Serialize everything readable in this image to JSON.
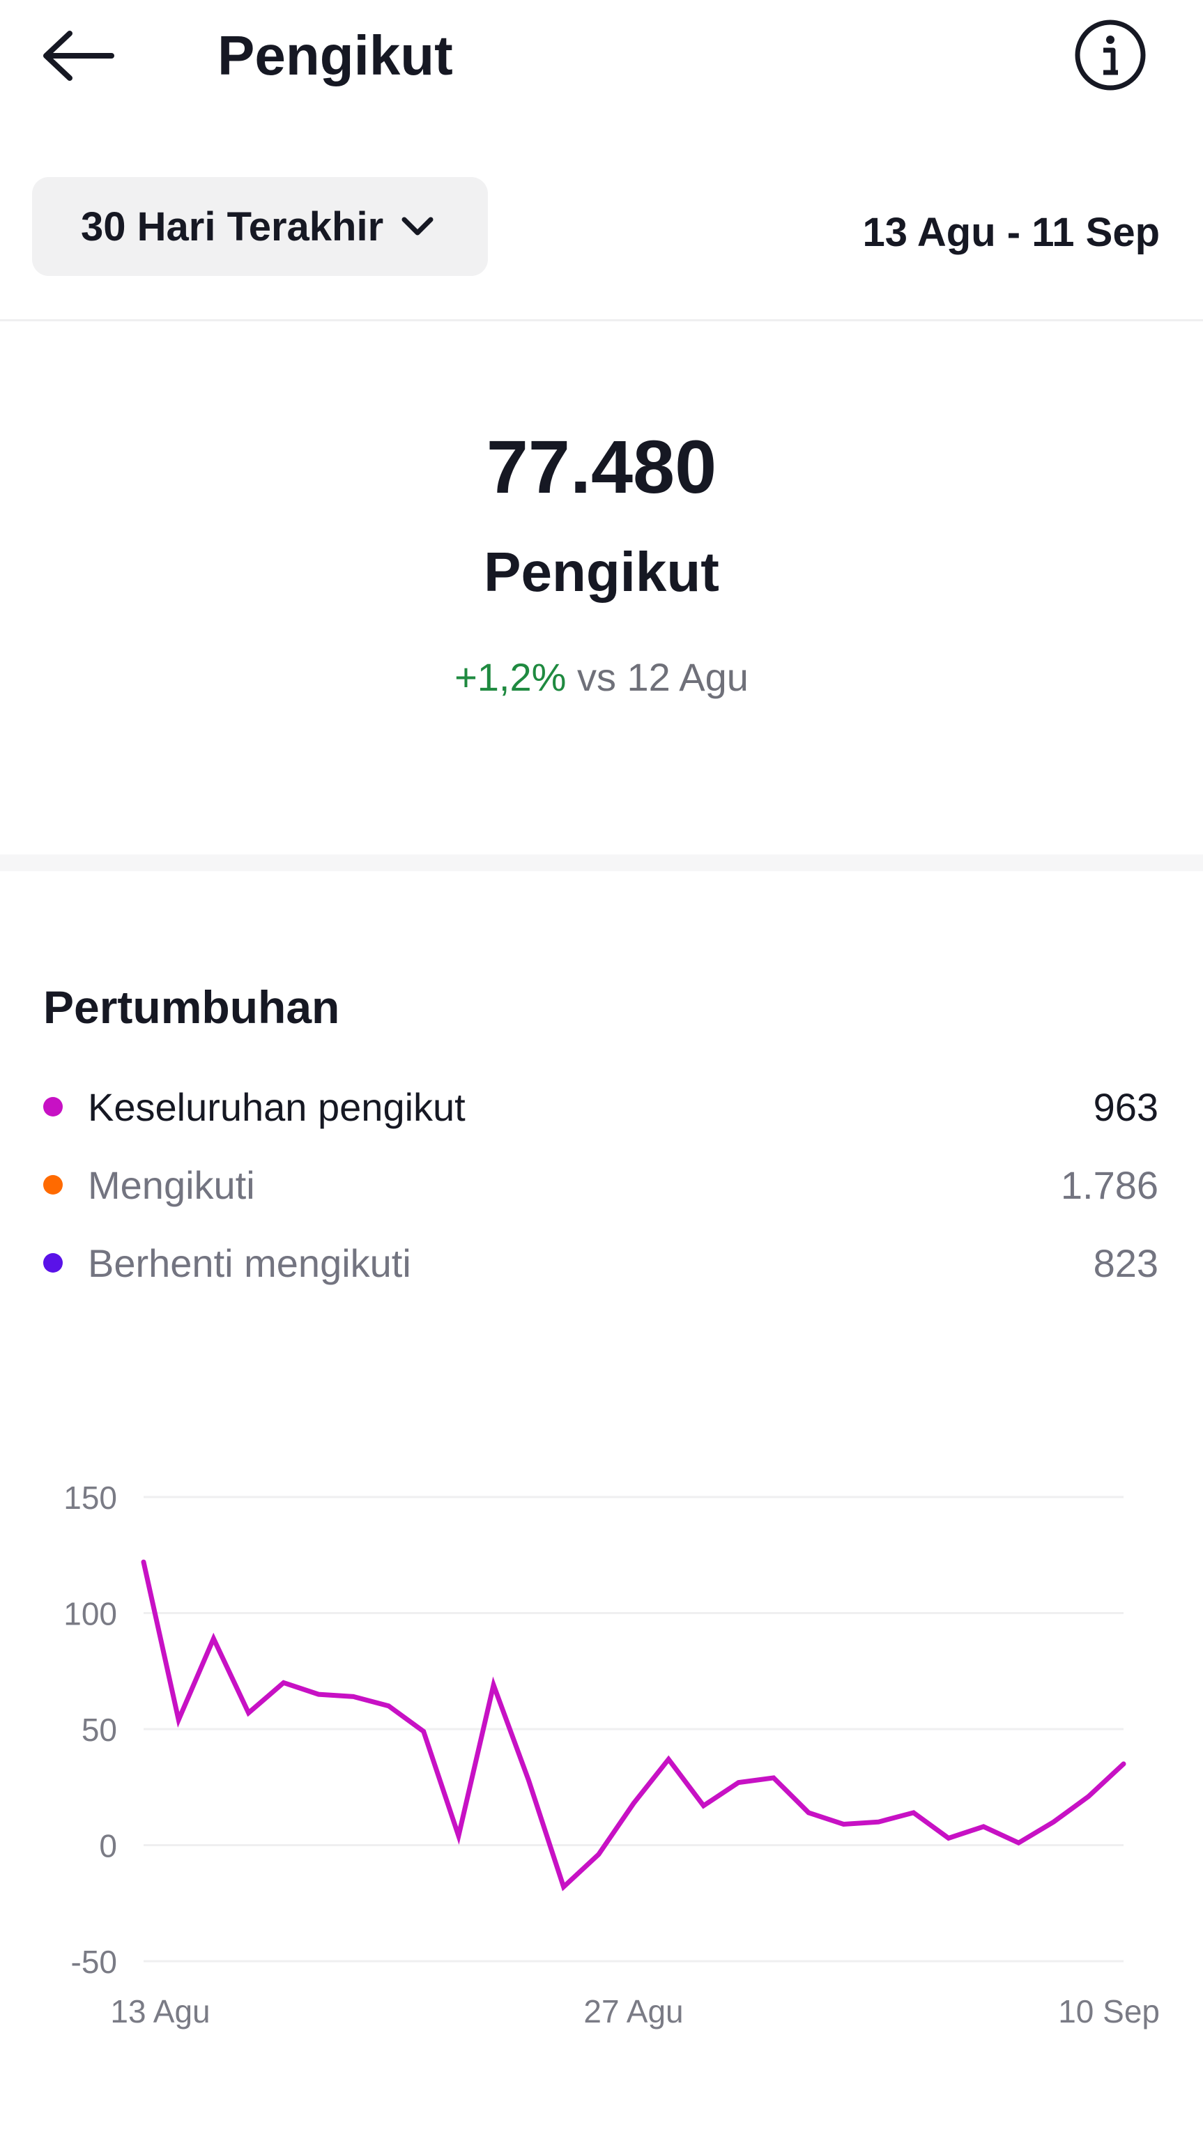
{
  "header": {
    "title": "Pengikut",
    "back_icon": "back-arrow-icon",
    "info_icon": "info-icon"
  },
  "filter": {
    "range_label": "30 Hari Terakhir",
    "range_icon": "chevron-down-icon",
    "date_range": "13 Agu - 11 Sep"
  },
  "summary": {
    "value": "77.480",
    "label": "Pengikut",
    "change": "+1,2%",
    "change_suffix": " vs 12 Agu",
    "change_color": "#1f8a40"
  },
  "growth": {
    "title": "Pertumbuhan",
    "legend": [
      {
        "label": "Keseluruhan pengikut",
        "value": "963",
        "color": "#c711c4"
      },
      {
        "label": "Mengikuti",
        "value": "1.786",
        "color": "#ff6a00"
      },
      {
        "label": "Berhenti mengikuti",
        "value": "823",
        "color": "#5a12e8"
      }
    ]
  },
  "chart_data": {
    "type": "line",
    "series": [
      {
        "color": "#c711c4",
        "values": [
          122,
          54,
          89,
          57,
          70,
          65,
          64,
          60,
          49,
          4,
          69,
          28,
          -18,
          -4,
          18,
          37,
          17,
          27,
          29,
          14,
          9,
          10,
          14,
          3,
          8,
          1,
          10,
          21,
          35
        ]
      }
    ],
    "ylim": [
      -50,
      150
    ],
    "yticks": [
      "150",
      "100",
      "50",
      "0",
      "-50"
    ],
    "ytick_values": [
      150,
      100,
      50,
      0,
      -50
    ],
    "xtick_labels": [
      "13 Agu",
      "27 Agu",
      "10 Sep"
    ],
    "xtick_indices": [
      0,
      14,
      28
    ],
    "grid": true
  }
}
